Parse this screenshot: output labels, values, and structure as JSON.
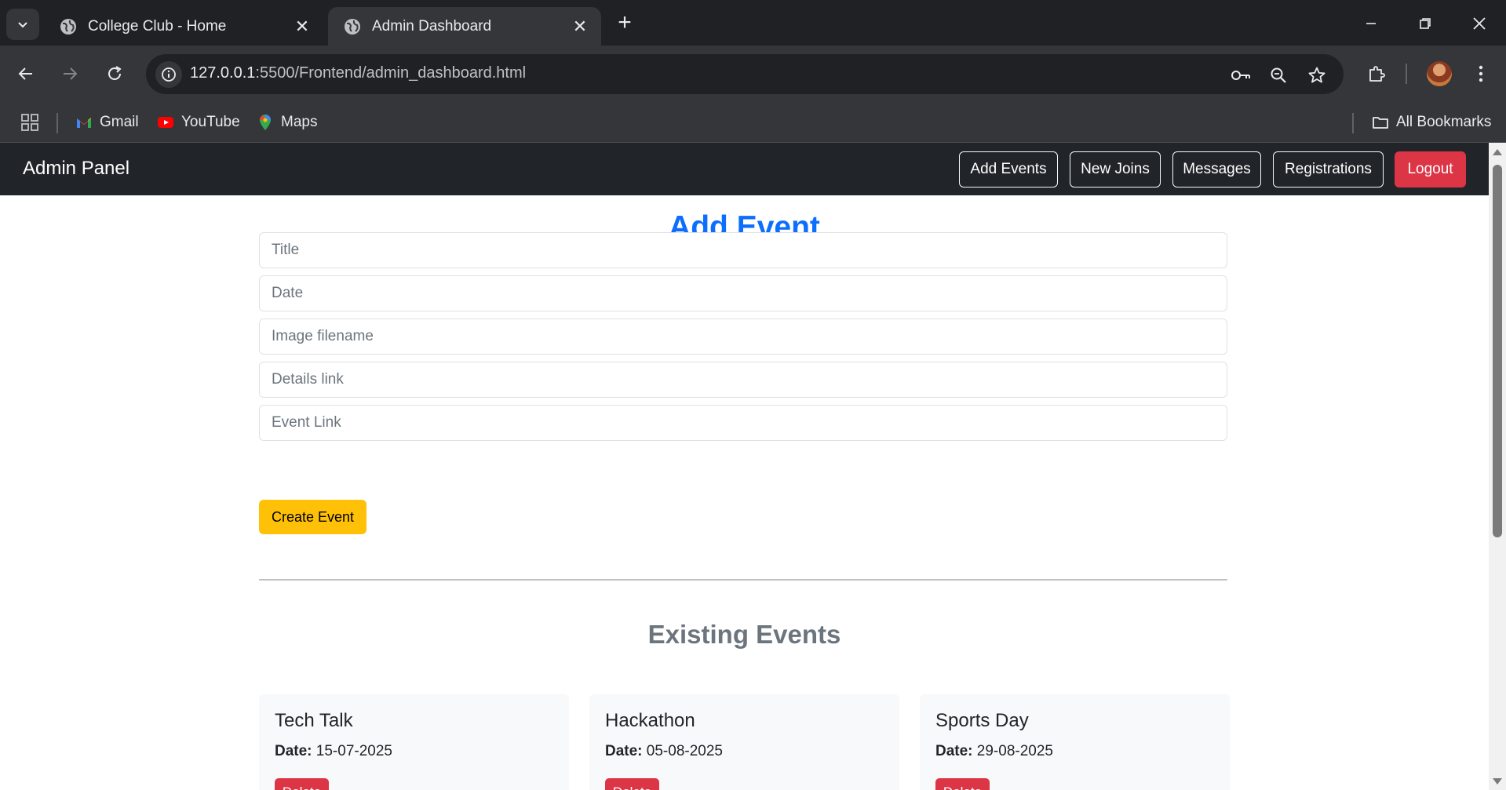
{
  "browser": {
    "tabs": [
      {
        "title": "College Club - Home",
        "active": false
      },
      {
        "title": "Admin Dashboard",
        "active": true
      }
    ],
    "url_host": "127.0.0.1",
    "url_path": ":5500/Frontend/admin_dashboard.html",
    "bookmarks": [
      {
        "label": "Gmail",
        "icon": "gmail-icon"
      },
      {
        "label": "YouTube",
        "icon": "youtube-icon"
      },
      {
        "label": "Maps",
        "icon": "maps-icon"
      }
    ],
    "all_bookmarks_label": "All Bookmarks"
  },
  "navbar": {
    "brand": "Admin Panel",
    "links": [
      "Add Events",
      "New Joins",
      "Messages",
      "Registrations"
    ],
    "logout": "Logout"
  },
  "form": {
    "heading": "Add Event",
    "placeholders": {
      "title": "Title",
      "date": "Date",
      "image": "Image filename",
      "details": "Details link",
      "event_link": "Event Link"
    },
    "submit_label": "Create Event"
  },
  "events": {
    "heading": "Existing Events",
    "date_label": "Date:",
    "delete_label": "Delete",
    "items": [
      {
        "title": "Tech Talk",
        "date": "15-07-2025"
      },
      {
        "title": "Hackathon",
        "date": "05-08-2025"
      },
      {
        "title": "Sports Day",
        "date": "29-08-2025"
      }
    ]
  },
  "colors": {
    "primary": "#0d6efd",
    "warning": "#ffc107",
    "danger": "#dc3545",
    "navbar": "#212529",
    "muted": "#6c757d"
  }
}
